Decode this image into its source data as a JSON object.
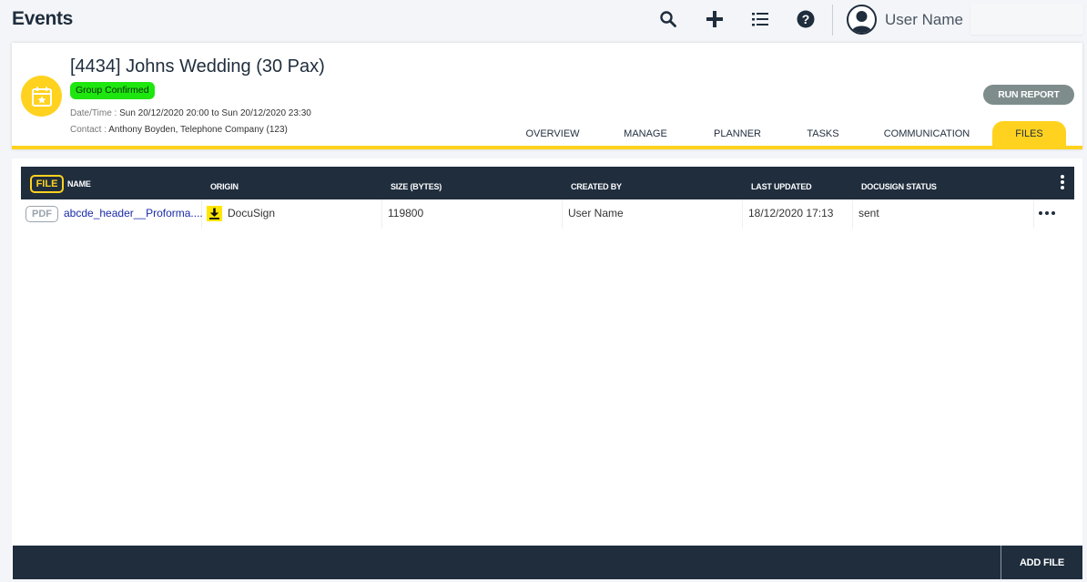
{
  "app": {
    "title": "Events"
  },
  "topbar": {
    "icons": [
      "search-icon",
      "plus-icon",
      "list-icon",
      "help-icon"
    ],
    "user_name": "User Name"
  },
  "event": {
    "title": "[4434] Johns Wedding (30 Pax)",
    "status": "Group Confirmed",
    "datetime_label": "Date/Time :",
    "datetime_value": "Sun 20/12/2020 20:00 to Sun 20/12/2020 23:30",
    "contact_label": "Contact :",
    "contact_value": "Anthony Boyden, Telephone Company (123)",
    "run_report_label": "RUN REPORT",
    "tabs": [
      {
        "label": "OVERVIEW",
        "active": false
      },
      {
        "label": "MANAGE",
        "active": false
      },
      {
        "label": "PLANNER",
        "active": false
      },
      {
        "label": "TASKS",
        "active": false
      },
      {
        "label": "COMMUNICATION",
        "active": false
      },
      {
        "label": "FILES",
        "active": true
      }
    ]
  },
  "files": {
    "file_chip": "FILE",
    "columns": [
      "NAME",
      "ORIGIN",
      "SIZE (BYTES)",
      "CREATED BY",
      "LAST UPDATED",
      "DOCUSIGN STATUS"
    ],
    "rows": [
      {
        "type": "PDF",
        "name": "abcde_header__Proforma....",
        "origin": "DocuSign",
        "size": "119800",
        "created_by": "User Name",
        "last_updated": "18/12/2020 17:13",
        "docusign_status": "sent"
      }
    ],
    "add_file_label": "ADD FILE"
  },
  "colors": {
    "navy": "#1f2d3d",
    "accent_yellow": "#ffd21f",
    "status_green": "#1ee60f",
    "run_report_gray": "#7e8c8c",
    "link_blue": "#1a2aa8"
  }
}
